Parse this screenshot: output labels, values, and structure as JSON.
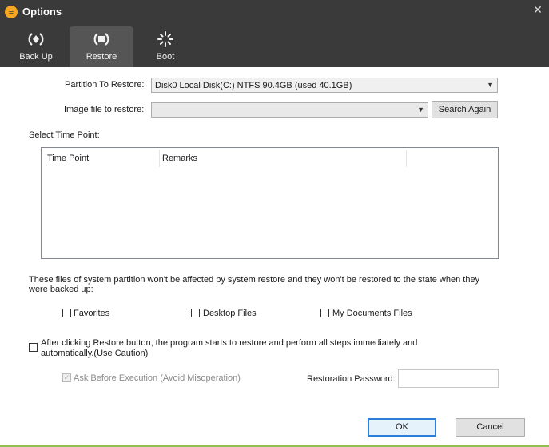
{
  "window": {
    "title": "Options",
    "close_glyph": "✕"
  },
  "tabs": [
    {
      "label": "Back Up",
      "icon": "backup-icon"
    },
    {
      "label": "Restore",
      "icon": "restore-icon",
      "active": true
    },
    {
      "label": "Boot",
      "icon": "boot-icon"
    }
  ],
  "form": {
    "partition_label": "Partition To Restore:",
    "partition_value": "Disk0  Local Disk(C:) NTFS 90.4GB (used 40.1GB)",
    "image_label": "Image file to restore:",
    "image_value": "",
    "search_again": "Search Again",
    "time_point_label": "Select Time Point:",
    "columns": [
      "Time Point",
      "Remarks"
    ]
  },
  "notice": {
    "text_line1": "These files of system partition won't be affected by system restore and they won't be restored to the state when they",
    "text_line2": "were backed up:",
    "options": [
      {
        "label": "Favorites",
        "checked": false
      },
      {
        "label": "Desktop Files",
        "checked": false
      },
      {
        "label": "My Documents Files",
        "checked": false
      }
    ]
  },
  "auto_restore": {
    "line1": "After clicking Restore button, the program starts to restore and perform all steps immediately and",
    "line2": "automatically.(Use Caution)",
    "checked": false
  },
  "ask_before": {
    "label": "Ask Before Execution (Avoid Misoperation)",
    "checked": true,
    "disabled": true
  },
  "password": {
    "label": "Restoration Password:",
    "value": ""
  },
  "buttons": {
    "ok": "OK",
    "cancel": "Cancel"
  },
  "colors": {
    "titlebar": "#3a3a3a",
    "accent": "#2b7fd8",
    "app_icon": "#f5a623"
  }
}
